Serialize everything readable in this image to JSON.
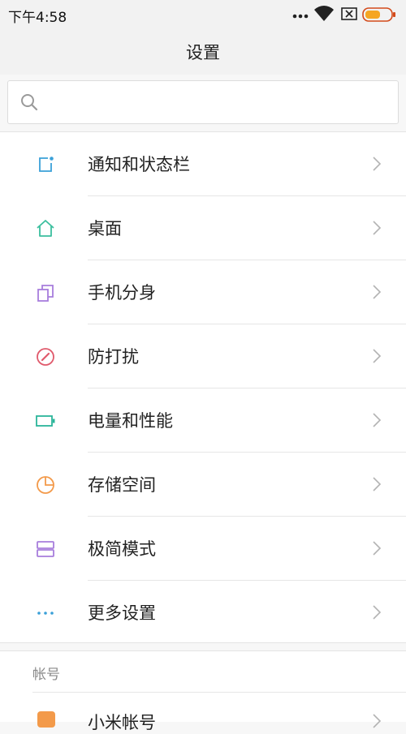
{
  "status": {
    "time": "下午4:58"
  },
  "header": {
    "title": "设置"
  },
  "search": {
    "placeholder": ""
  },
  "menu": [
    {
      "label": "通知和状态栏",
      "icon": "notification-icon",
      "color": "#3aa0d8"
    },
    {
      "label": "桌面",
      "icon": "home-icon",
      "color": "#3bbf9e"
    },
    {
      "label": "手机分身",
      "icon": "second-space-icon",
      "color": "#a77ddc"
    },
    {
      "label": "防打扰",
      "icon": "do-not-disturb-icon",
      "color": "#e05a6c"
    },
    {
      "label": "电量和性能",
      "icon": "battery-icon",
      "color": "#2bb59a"
    },
    {
      "label": "存储空间",
      "icon": "storage-icon",
      "color": "#f39a4a"
    },
    {
      "label": "极简模式",
      "icon": "simple-mode-icon",
      "color": "#a77ddc"
    },
    {
      "label": "更多设置",
      "icon": "more-settings-icon",
      "color": "#3aa0d8"
    }
  ],
  "account_section": {
    "title": "帐号",
    "items": [
      {
        "label": "小米帐号",
        "icon": "mi-account-icon",
        "color": "#f39a4a"
      }
    ]
  },
  "colors": {
    "chevron": "#b3b3b3",
    "battery_fill": "#f5a623"
  }
}
